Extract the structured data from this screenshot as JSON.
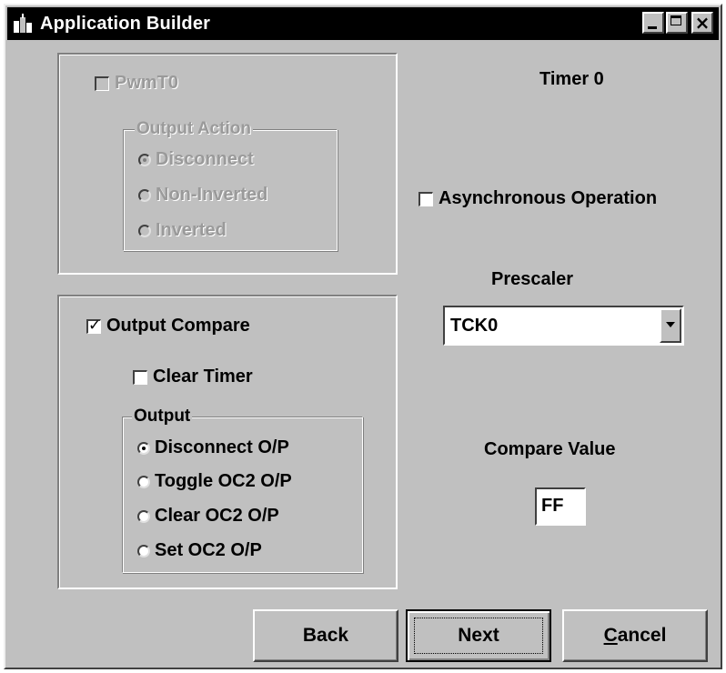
{
  "window": {
    "title": "Application Builder"
  },
  "pwm_group": {
    "pwm_checkbox_label": "PwmT0",
    "pwm_checked": false,
    "output_action": {
      "legend": "Output Action",
      "options": [
        {
          "label": "Disconnect",
          "selected": true
        },
        {
          "label": "Non-Inverted",
          "selected": false
        },
        {
          "label": "Inverted",
          "selected": false
        }
      ]
    }
  },
  "compare_group": {
    "output_compare_label": "Output Compare",
    "output_compare_checked": true,
    "clear_timer_label": "Clear Timer",
    "clear_timer_checked": false,
    "output": {
      "legend": "Output",
      "options": [
        {
          "label": "Disconnect O/P",
          "selected": true
        },
        {
          "label": "Toggle OC2 O/P",
          "selected": false
        },
        {
          "label": "Clear OC2 O/P",
          "selected": false
        },
        {
          "label": "Set OC2 O/P",
          "selected": false
        }
      ]
    }
  },
  "right_panel": {
    "timer_heading": "Timer 0",
    "async_label": "Asynchronous Operation",
    "async_checked": false,
    "prescaler_label": "Prescaler",
    "prescaler_value": "TCK0",
    "compare_value_label": "Compare Value",
    "compare_value": "FF"
  },
  "buttons": {
    "back": "Back",
    "next": "Next",
    "cancel": "Cancel"
  }
}
